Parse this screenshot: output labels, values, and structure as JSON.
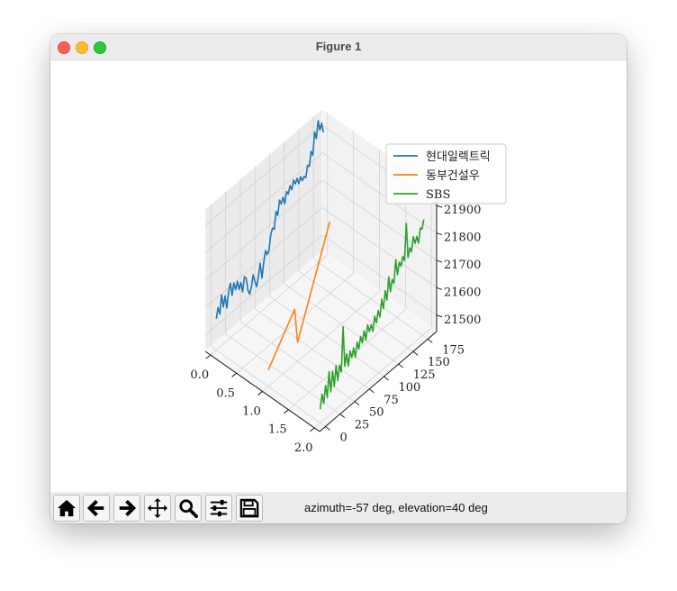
{
  "window": {
    "title": "Figure 1"
  },
  "toolbar": {
    "buttons": [
      {
        "name": "home-button",
        "icon": "home-icon"
      },
      {
        "name": "back-button",
        "icon": "arrow-left-icon"
      },
      {
        "name": "forward-button",
        "icon": "arrow-right-icon"
      },
      {
        "name": "pan-button",
        "icon": "move-icon"
      },
      {
        "name": "zoom-button",
        "icon": "magnifier-icon"
      },
      {
        "name": "configure-subplots-button",
        "icon": "sliders-icon"
      },
      {
        "name": "save-button",
        "icon": "floppy-disk-icon"
      }
    ],
    "status": "azimuth=-57 deg, elevation=40 deg"
  },
  "chart_data": {
    "type": "line",
    "projection": "3d",
    "view": {
      "azimuth": -57,
      "elevation": 40
    },
    "title": "",
    "xlabel": "",
    "ylabel": "",
    "zlabel": "",
    "xlim": [
      -0.1,
      2.1
    ],
    "ylim": [
      -10,
      190
    ],
    "zlim": [
      21440,
      21960
    ],
    "xticks": [
      "0.0",
      "0.5",
      "1.0",
      "1.5",
      "2.0"
    ],
    "yticks": [
      "0",
      "25",
      "50",
      "75",
      "100",
      "125",
      "150",
      "175"
    ],
    "zticks": [
      "21500",
      "21600",
      "21700",
      "21800",
      "21900"
    ],
    "grid": true,
    "legend": {
      "position": "upper-right",
      "entries": [
        "현대일렉트릭",
        "동부건설우",
        "SBS"
      ]
    },
    "series": [
      {
        "name": "현대일렉트릭",
        "color": "#1f77b4",
        "x": 0,
        "points": [
          [
            0,
            21555
          ],
          [
            3,
            21590
          ],
          [
            6,
            21560
          ],
          [
            9,
            21625
          ],
          [
            12,
            21575
          ],
          [
            15,
            21610
          ],
          [
            18,
            21560
          ],
          [
            21,
            21615
          ],
          [
            24,
            21640
          ],
          [
            27,
            21590
          ],
          [
            30,
            21630
          ],
          [
            33,
            21600
          ],
          [
            36,
            21625
          ],
          [
            39,
            21590
          ],
          [
            42,
            21610
          ],
          [
            45,
            21570
          ],
          [
            48,
            21620
          ],
          [
            51,
            21610
          ],
          [
            54,
            21560
          ],
          [
            57,
            21540
          ],
          [
            60,
            21560
          ],
          [
            63,
            21600
          ],
          [
            66,
            21570
          ],
          [
            69,
            21545
          ],
          [
            72,
            21580
          ],
          [
            75,
            21620
          ],
          [
            78,
            21560
          ],
          [
            81,
            21610
          ],
          [
            84,
            21650
          ],
          [
            87,
            21630
          ],
          [
            90,
            21640
          ],
          [
            93,
            21690
          ],
          [
            96,
            21710
          ],
          [
            99,
            21700
          ],
          [
            102,
            21760
          ],
          [
            105,
            21740
          ],
          [
            108,
            21790
          ],
          [
            111,
            21770
          ],
          [
            114,
            21790
          ],
          [
            117,
            21760
          ],
          [
            120,
            21800
          ],
          [
            123,
            21785
          ],
          [
            126,
            21810
          ],
          [
            129,
            21790
          ],
          [
            132,
            21820
          ],
          [
            135,
            21800
          ],
          [
            138,
            21815
          ],
          [
            141,
            21790
          ],
          [
            144,
            21810
          ],
          [
            147,
            21790
          ],
          [
            150,
            21800
          ],
          [
            153,
            21790
          ],
          [
            156,
            21830
          ],
          [
            159,
            21820
          ],
          [
            162,
            21870
          ],
          [
            165,
            21850
          ],
          [
            168,
            21930
          ],
          [
            171,
            21900
          ],
          [
            174,
            21960
          ],
          [
            177,
            21920
          ],
          [
            180,
            21940
          ],
          [
            183,
            21900
          ]
        ]
      },
      {
        "name": "동부건설우",
        "color": "#ff7f0e",
        "x": 1,
        "points": [
          [
            0,
            21500
          ],
          [
            45,
            21640
          ],
          [
            50,
            21510
          ],
          [
            105,
            21850
          ]
        ]
      },
      {
        "name": "SBS",
        "color": "#2ca02c",
        "x": 2,
        "points": [
          [
            0,
            21490
          ],
          [
            3,
            21540
          ],
          [
            6,
            21500
          ],
          [
            9,
            21560
          ],
          [
            12,
            21510
          ],
          [
            15,
            21600
          ],
          [
            18,
            21520
          ],
          [
            21,
            21590
          ],
          [
            24,
            21530
          ],
          [
            27,
            21600
          ],
          [
            30,
            21540
          ],
          [
            33,
            21590
          ],
          [
            36,
            21560
          ],
          [
            39,
            21720
          ],
          [
            42,
            21570
          ],
          [
            45,
            21610
          ],
          [
            48,
            21560
          ],
          [
            51,
            21610
          ],
          [
            54,
            21580
          ],
          [
            57,
            21610
          ],
          [
            60,
            21570
          ],
          [
            63,
            21620
          ],
          [
            66,
            21590
          ],
          [
            69,
            21630
          ],
          [
            72,
            21600
          ],
          [
            75,
            21640
          ],
          [
            78,
            21600
          ],
          [
            81,
            21650
          ],
          [
            84,
            21620
          ],
          [
            87,
            21640
          ],
          [
            90,
            21610
          ],
          [
            93,
            21660
          ],
          [
            96,
            21630
          ],
          [
            99,
            21670
          ],
          [
            102,
            21640
          ],
          [
            105,
            21700
          ],
          [
            108,
            21660
          ],
          [
            111,
            21720
          ],
          [
            114,
            21680
          ],
          [
            117,
            21760
          ],
          [
            120,
            21700
          ],
          [
            123,
            21740
          ],
          [
            126,
            21720
          ],
          [
            129,
            21800
          ],
          [
            132,
            21740
          ],
          [
            135,
            21780
          ],
          [
            138,
            21760
          ],
          [
            141,
            21790
          ],
          [
            144,
            21770
          ],
          [
            147,
            21900
          ],
          [
            150,
            21770
          ],
          [
            153,
            21800
          ],
          [
            156,
            21780
          ],
          [
            159,
            21830
          ],
          [
            162,
            21800
          ],
          [
            165,
            21820
          ],
          [
            168,
            21790
          ],
          [
            171,
            21840
          ],
          [
            174,
            21830
          ],
          [
            177,
            21860
          ]
        ]
      }
    ]
  }
}
